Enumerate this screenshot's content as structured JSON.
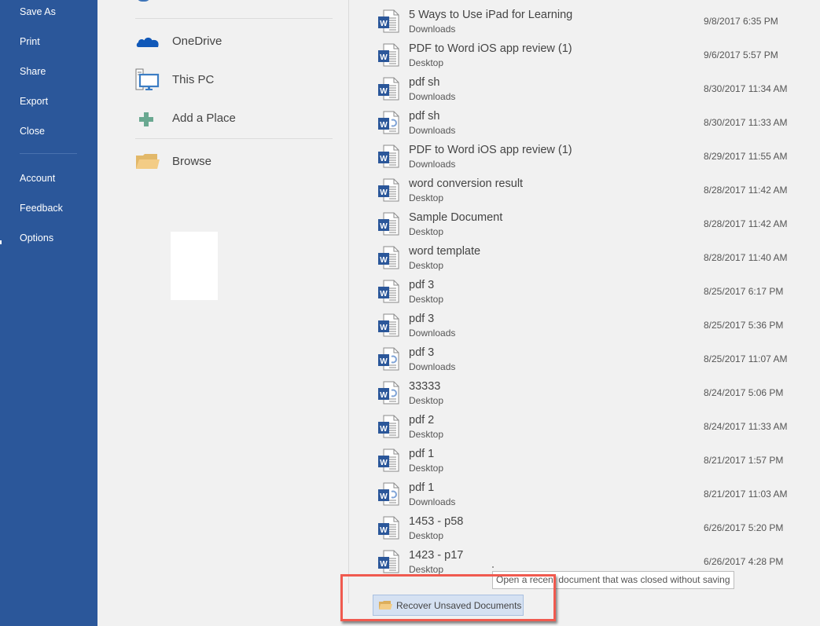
{
  "sidebar": {
    "items": [
      {
        "label": "Save As"
      },
      {
        "label": "Print"
      },
      {
        "label": "Share"
      },
      {
        "label": "Export"
      },
      {
        "label": "Close"
      },
      {
        "label": "Account"
      },
      {
        "label": "Feedback"
      },
      {
        "label": "Options"
      }
    ],
    "background": "#2b579a"
  },
  "places": {
    "items": [
      {
        "label": "OneDrive",
        "icon": "onedrive-cloud-icon"
      },
      {
        "label": "This PC",
        "icon": "computer-icon"
      },
      {
        "label": "Add a Place",
        "icon": "plus-icon"
      },
      {
        "label": "Browse",
        "icon": "folder-icon"
      }
    ]
  },
  "recent": {
    "documents": [
      {
        "name": "5 Ways to Use iPad for Learning",
        "location": "Downloads",
        "date": "9/8/2017 6:35 PM",
        "icon": "word-doc-icon"
      },
      {
        "name": "PDF to Word iOS app review (1)",
        "location": "Desktop",
        "date": "9/6/2017 5:57 PM",
        "icon": "word-doc-icon"
      },
      {
        "name": "pdf sh",
        "location": "Downloads",
        "date": "8/30/2017 11:34 AM",
        "icon": "word-doc-icon"
      },
      {
        "name": "pdf sh",
        "location": "Downloads",
        "date": "8/30/2017 11:33 AM",
        "icon": "word-converted-doc-icon"
      },
      {
        "name": "PDF to Word iOS app review (1)",
        "location": "Downloads",
        "date": "8/29/2017 11:55 AM",
        "icon": "word-doc-icon"
      },
      {
        "name": "word conversion result",
        "location": "Desktop",
        "date": "8/28/2017 11:42 AM",
        "icon": "word-doc-icon"
      },
      {
        "name": "Sample Document",
        "location": "Desktop",
        "date": "8/28/2017 11:42 AM",
        "icon": "word-doc-icon"
      },
      {
        "name": "word template",
        "location": "Desktop",
        "date": "8/28/2017 11:40 AM",
        "icon": "word-doc-icon"
      },
      {
        "name": "pdf 3",
        "location": "Desktop",
        "date": "8/25/2017 6:17 PM",
        "icon": "word-doc-icon"
      },
      {
        "name": "pdf 3",
        "location": "Downloads",
        "date": "8/25/2017 5:36 PM",
        "icon": "word-doc-icon"
      },
      {
        "name": "pdf 3",
        "location": "Downloads",
        "date": "8/25/2017 11:07 AM",
        "icon": "word-converted-doc-icon"
      },
      {
        "name": "33333",
        "location": "Desktop",
        "date": "8/24/2017 5:06 PM",
        "icon": "word-converted-doc-icon"
      },
      {
        "name": "pdf 2",
        "location": "Desktop",
        "date": "8/24/2017 11:33 AM",
        "icon": "word-doc-icon"
      },
      {
        "name": "pdf 1",
        "location": "Desktop",
        "date": "8/21/2017 1:57 PM",
        "icon": "word-doc-icon"
      },
      {
        "name": "pdf 1",
        "location": "Downloads",
        "date": "8/21/2017 11:03 AM",
        "icon": "word-converted-doc-icon"
      },
      {
        "name": "1453 - p58",
        "location": "Desktop",
        "date": "6/26/2017 5:20 PM",
        "icon": "word-doc-icon"
      },
      {
        "name": "1423 - p17",
        "location": "Desktop",
        "date": "6/26/2017 4:28 PM",
        "icon": "word-doc-icon"
      }
    ]
  },
  "recover": {
    "button_label": "Recover Unsaved Documents",
    "tooltip": "Open a recent document that was closed without saving",
    "highlight_color": "#f05a4f"
  }
}
